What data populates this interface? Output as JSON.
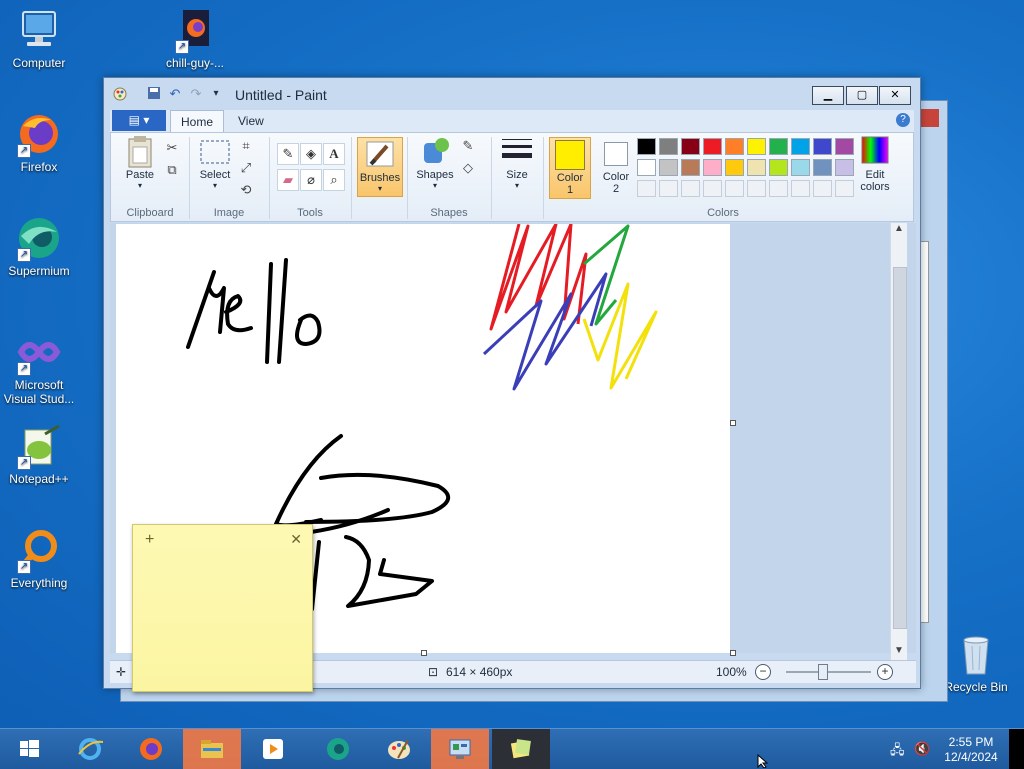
{
  "desktop": {
    "icons": [
      {
        "label": "Computer",
        "icon": "computer-icon"
      },
      {
        "label": "chill-guy-...",
        "icon": "firefox-file-icon"
      },
      {
        "label": "Firefox",
        "icon": "firefox-icon"
      },
      {
        "label": "Supermium",
        "icon": "supermium-icon"
      },
      {
        "label": "Microsoft Visual Stud...",
        "icon": "visual-studio-icon"
      },
      {
        "label": "Notepad++",
        "icon": "notepadpp-icon"
      },
      {
        "label": "Everything",
        "icon": "everything-icon"
      },
      {
        "label": "Recycle Bin",
        "icon": "recycle-bin-icon"
      }
    ]
  },
  "paint": {
    "title": "Untitled - Paint",
    "window_buttons": {
      "minimize": "▁",
      "maximize": "▢",
      "close": "✕"
    },
    "menu": {
      "file_glyph": "▤ ▾",
      "tabs": [
        "Home",
        "View"
      ],
      "active_tab": "Home"
    },
    "ribbon": {
      "groups": [
        "Clipboard",
        "Image",
        "Tools",
        "Shapes",
        "Colors"
      ],
      "paste_label": "Paste",
      "select_label": "Select",
      "brushes_label": "Brushes",
      "shapes_label": "Shapes",
      "size_label": "Size",
      "color1_label": "Color",
      "color1_num": "1",
      "color2_label": "Color",
      "color2_num": "2",
      "edit_colors_label": "Edit",
      "edit_colors_label2": "colors",
      "color1": "#ffee00",
      "color2": "#ffffff",
      "palette_row1": [
        "#000000",
        "#7f7f7f",
        "#880015",
        "#ed1c24",
        "#ff7f27",
        "#fff200",
        "#22b14c",
        "#00a2e8",
        "#3f48cc",
        "#a349a4"
      ],
      "palette_row2": [
        "#ffffff",
        "#c3c3c3",
        "#b97a57",
        "#ffaec9",
        "#ffc90e",
        "#efe4b0",
        "#b5e61d",
        "#99d9ea",
        "#7092be",
        "#c8bfe7"
      ]
    },
    "canvas": {
      "drawing": "hello scribbles"
    },
    "status": {
      "dimensions": "614 × 460px",
      "zoom": "100%"
    }
  },
  "taskbar": {
    "clock_time": "2:55 PM",
    "clock_date": "12/4/2024"
  }
}
